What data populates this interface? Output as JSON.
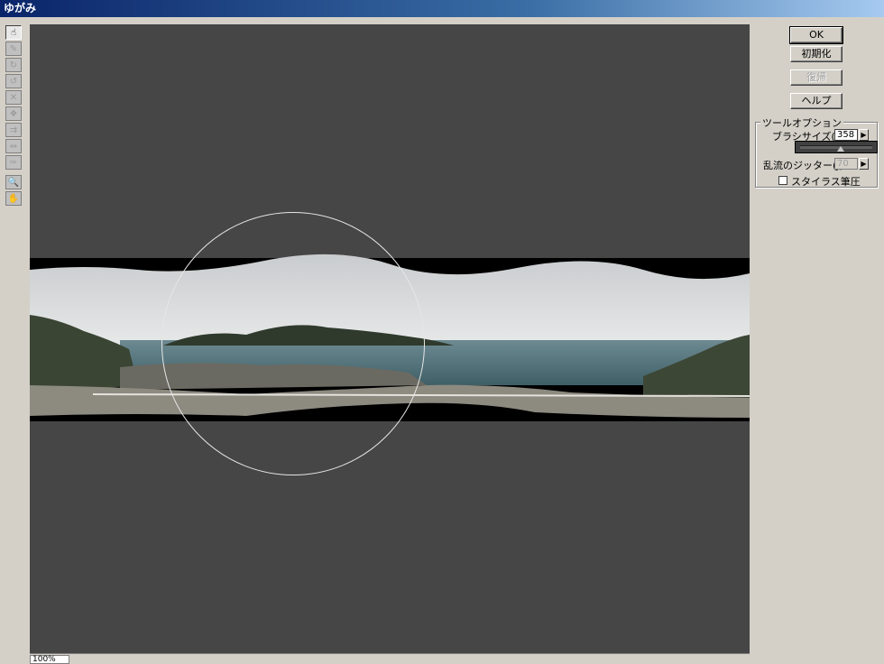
{
  "window": {
    "title": "ゆがみ"
  },
  "tools": [
    {
      "name": "forward-warp-icon",
      "glyph": "☝",
      "active": true
    },
    {
      "name": "reconstruct-icon",
      "glyph": "✎",
      "dim": true
    },
    {
      "name": "twirl-cw-icon",
      "glyph": "↻",
      "dim": true
    },
    {
      "name": "twirl-ccw-icon",
      "glyph": "↺",
      "dim": true
    },
    {
      "name": "pucker-icon",
      "glyph": "✕",
      "dim": true
    },
    {
      "name": "bloat-icon",
      "glyph": "❖",
      "dim": true
    },
    {
      "name": "shift-pixels-icon",
      "glyph": "⇉",
      "dim": true
    },
    {
      "name": "reflect-icon",
      "glyph": "⇔",
      "dim": true
    },
    {
      "name": "turbulence-icon",
      "glyph": "✑",
      "dim": true
    },
    {
      "name": "zoom-icon",
      "glyph": "🔍",
      "gap": true
    },
    {
      "name": "hand-icon",
      "glyph": "✋"
    }
  ],
  "buttons": {
    "ok": "OK",
    "reset": "初期化",
    "restore": "復帰",
    "help": "ヘルプ"
  },
  "tool_options": {
    "title": "ツールオプション",
    "brush_size_label": "ブラシサイズ(S):",
    "brush_size_value": "358",
    "jitter_label": "乱流のジッター(J):",
    "jitter_value": "70",
    "stylus_label": "スタイラス筆圧"
  },
  "status": {
    "zoom": "100%"
  },
  "colors": {
    "canvas": "#464646",
    "dialog": "#d4d0c8"
  }
}
